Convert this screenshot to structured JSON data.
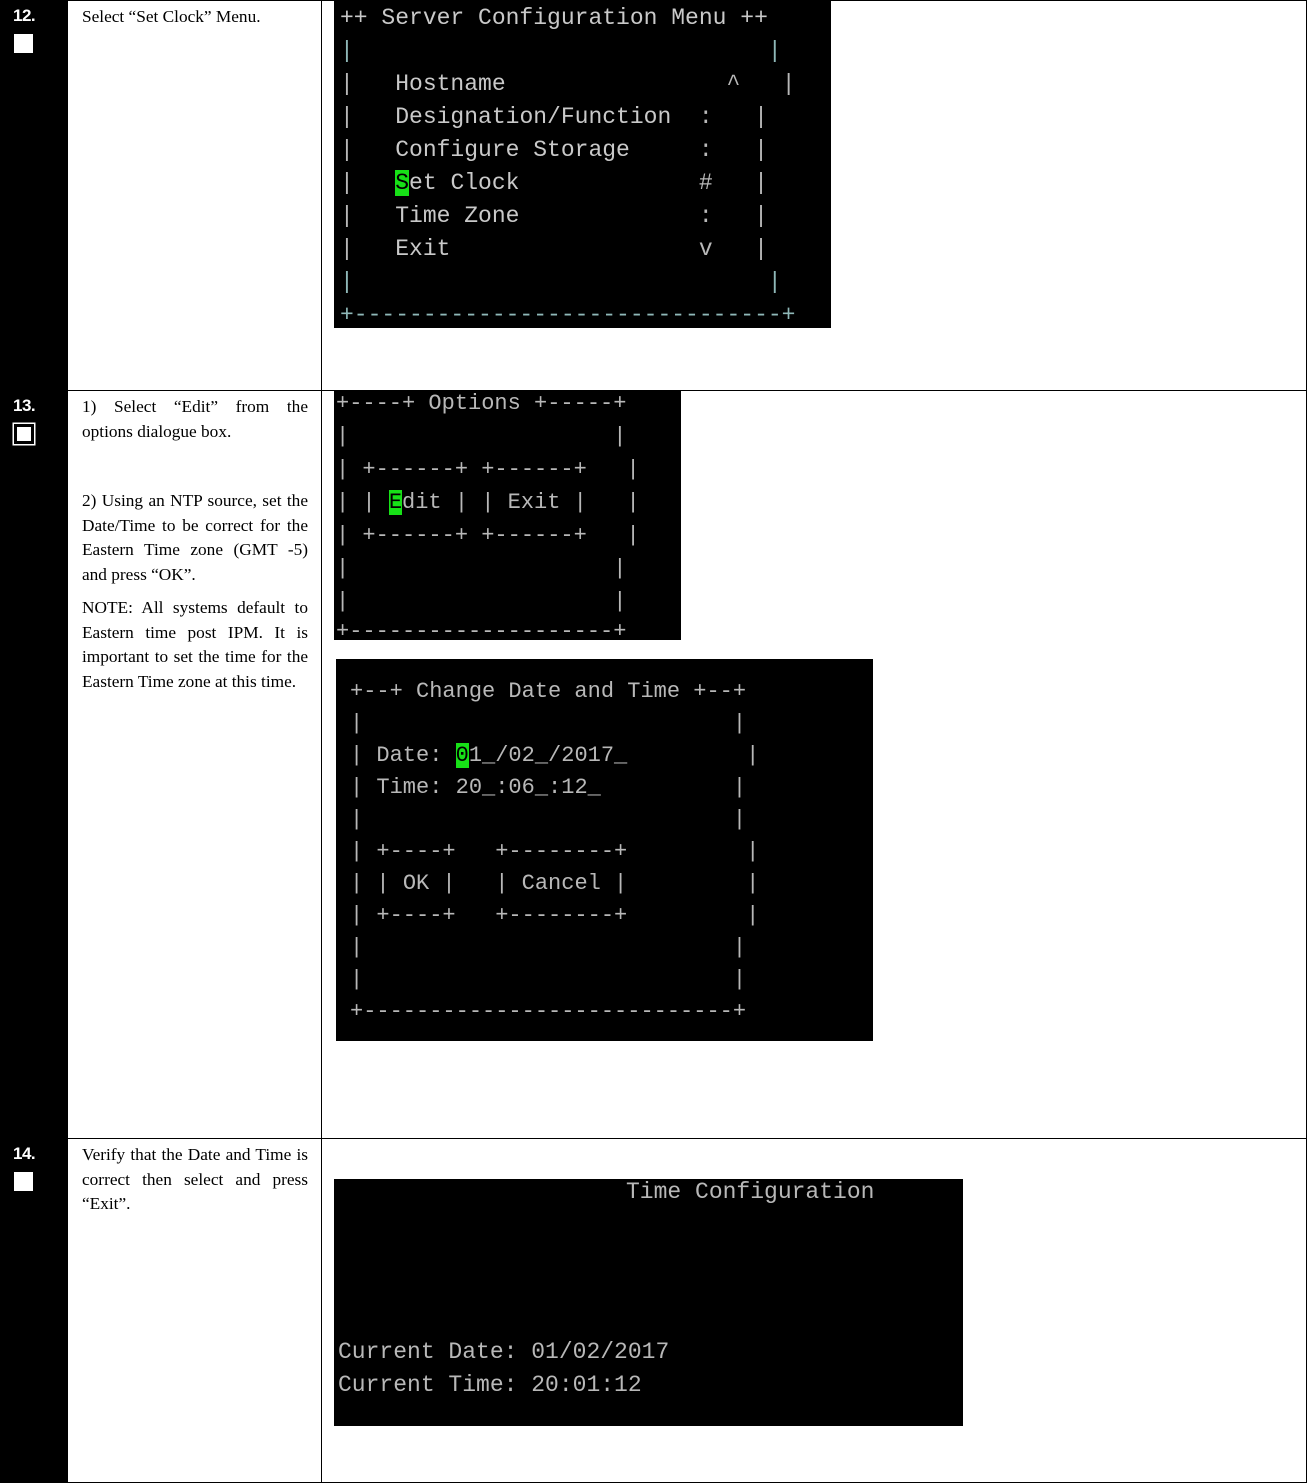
{
  "steps": [
    {
      "number": "12.",
      "description": [
        "Select “Set Clock” Menu."
      ],
      "terminal": {
        "title": "++ Server Configuration Menu ++",
        "menu_items": [
          {
            "label": "Hostname",
            "marker": "^"
          },
          {
            "label": "Designation/Function",
            "marker": ":"
          },
          {
            "label": "Configure Storage",
            "marker": ":"
          },
          {
            "label": "Set Clock",
            "marker": "#",
            "highlight_char": "S",
            "rest": "et Clock"
          },
          {
            "label": "Time Zone",
            "marker": ":"
          },
          {
            "label": "Exit",
            "marker": "v"
          }
        ],
        "bottom_border": "+-------------------------------+"
      }
    },
    {
      "number": "13.",
      "description": [
        "1) Select “Edit” from the options dialogue box.",
        "2) Using an NTP source, set the Date/Time to be correct for the Eastern Time zone (GMT -5) and press “OK”.",
        "NOTE: All systems default to Eastern time post IPM. It is important to set the time for the Eastern Time zone at this time."
      ],
      "options_dialog": {
        "title_line": "+----+ Options +-----+",
        "button_top": "| +------+ +------+   |",
        "edit_highlight": "E",
        "edit_rest": "dit",
        "exit_label": "Exit",
        "button_bottom": "| +------+ +------+   |",
        "bottom_border": "+--------------------+"
      },
      "datetime_dialog": {
        "title_line": "+--+ Change Date and Time +--+",
        "date_label": "Date:",
        "date_highlight": "0",
        "date_rest": "1_/02_/2017_",
        "time_label": "Time:",
        "time_value": "20_:06_:12_",
        "button_top": "| +----+   +--------+         |",
        "ok_label": "OK",
        "cancel_label": "Cancel",
        "button_bottom": "| +----+   +--------+         |",
        "bottom_border": "+----------------------------+"
      }
    },
    {
      "number": "14.",
      "description": [
        "Verify that the Date and Time is correct then select and press “Exit”."
      ],
      "time_config": {
        "title": "Time Configuration",
        "current_date": "Current Date: 01/02/2017",
        "current_time": "Current Time: 20:01:12"
      }
    }
  ]
}
